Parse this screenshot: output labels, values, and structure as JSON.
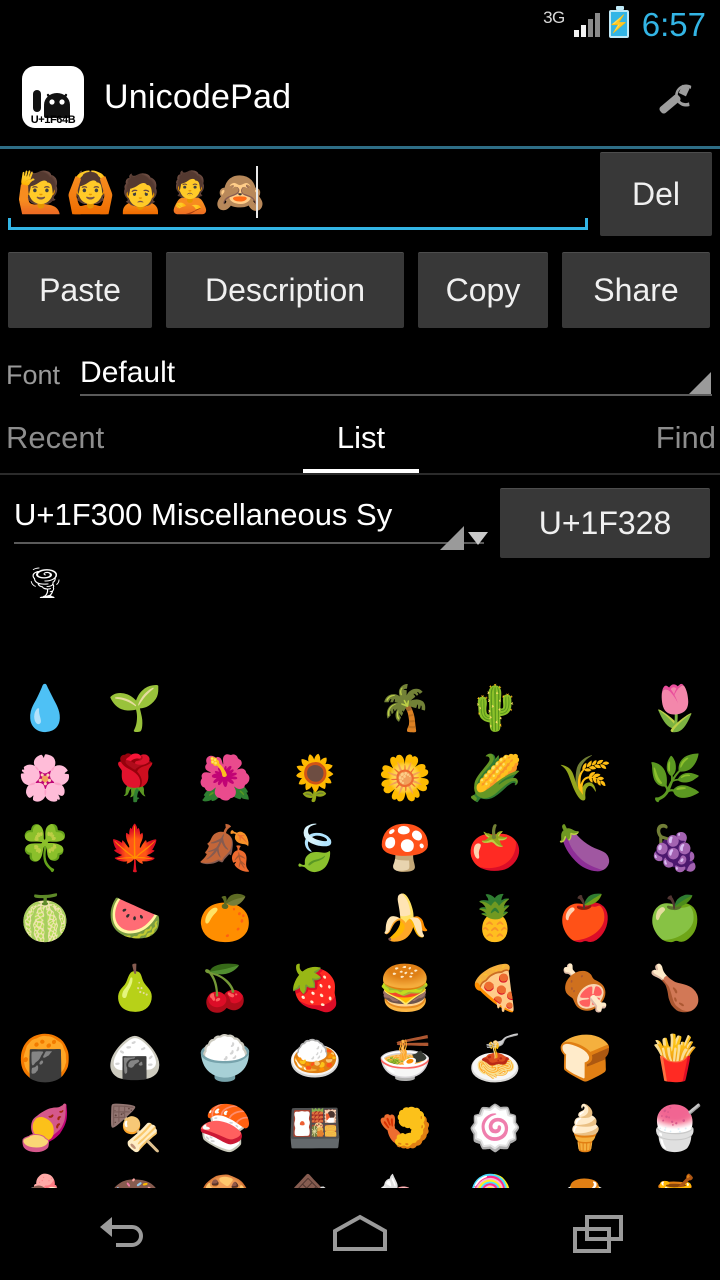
{
  "statusbar": {
    "network_label": "3G",
    "time": "6:57",
    "battery_state": "charging",
    "signal_bars_filled": 2,
    "signal_bars_total": 4,
    "accent_color": "#33b5e5"
  },
  "actionbar": {
    "app_icon_code": "U+1F64B",
    "title": "UnicodePad",
    "settings_icon": "wrench-icon"
  },
  "editor": {
    "text": "🙋🙆🙍🙎🙈",
    "placeholder": "",
    "delete_label": "Del",
    "underline_color": "#33b5e5"
  },
  "actions": {
    "paste": "Paste",
    "description": "Description",
    "copy": "Copy",
    "share": "Share"
  },
  "font": {
    "label": "Font",
    "value": "Default"
  },
  "tabs": [
    {
      "label": "Recent",
      "active": false
    },
    {
      "label": "List",
      "active": true
    },
    {
      "label": "Find",
      "active": false
    }
  ],
  "block": {
    "value": "U+1F300 Miscellaneous Sy",
    "code_button": "U+1F328"
  },
  "grid": {
    "columns": 8,
    "rows": [
      {
        "cells": [
          "🌪",
          "",
          "",
          "",
          "",
          "",
          "",
          ""
        ]
      },
      {
        "cells": [
          "",
          "",
          "",
          "",
          "",
          "",
          "",
          ""
        ]
      },
      {
        "cells": [
          "💧",
          "🌱",
          "",
          "",
          "🌴",
          "🌵",
          "",
          "🌷"
        ]
      },
      {
        "cells": [
          "🌸",
          "🌹",
          "🌺",
          "🌻",
          "🌼",
          "🌽",
          "🌾",
          "🌿"
        ]
      },
      {
        "cells": [
          "🍀",
          "🍁",
          "🍂",
          "🍃",
          "🍄",
          "🍅",
          "🍆",
          "🍇"
        ]
      },
      {
        "cells": [
          "🍈",
          "🍉",
          "🍊",
          "",
          "🍌",
          "🍍",
          "🍎",
          "🍏"
        ]
      },
      {
        "cells": [
          "",
          "🍐",
          "🍒",
          "🍓",
          "🍔",
          "🍕",
          "🍖",
          "🍗"
        ]
      },
      {
        "cells": [
          "🍘",
          "🍙",
          "🍚",
          "🍛",
          "🍜",
          "🍝",
          "🍞",
          "🍟"
        ]
      },
      {
        "cells": [
          "🍠",
          "🍢",
          "🍣",
          "🍱",
          "🍤",
          "🍥",
          "🍦",
          "🍧"
        ]
      },
      {
        "cells": [
          "🍨",
          "🍩",
          "🍪",
          "🍫",
          "🍬",
          "🍭",
          "🍮",
          "🍯"
        ]
      }
    ]
  },
  "navbar": {
    "back": "back-nav-button",
    "home": "home-nav-button",
    "recents": "recents-nav-button"
  }
}
